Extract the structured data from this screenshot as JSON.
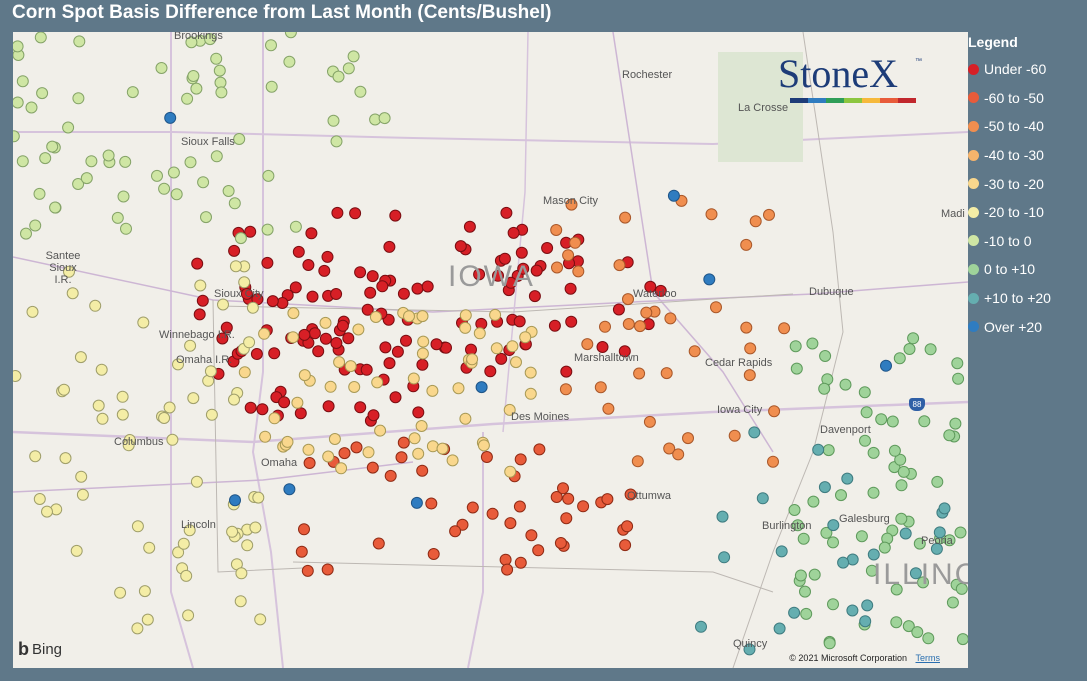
{
  "title": "Corn Spot Basis Difference from Last Month (Cents/Bushel)",
  "legend": {
    "title": "Legend",
    "items": [
      {
        "label": "Under -60",
        "color": "#d71f26"
      },
      {
        "label": "-60 to -50",
        "color": "#e85b3a"
      },
      {
        "label": "-50 to -40",
        "color": "#f08e4f"
      },
      {
        "label": "-40 to -30",
        "color": "#f6b46c"
      },
      {
        "label": "-30 to -20",
        "color": "#f9d78d"
      },
      {
        "label": "-20 to -10",
        "color": "#f4eda6"
      },
      {
        "label": "-10 to 0",
        "color": "#cfe6a4"
      },
      {
        "label": "0 to +10",
        "color": "#9fd39a"
      },
      {
        "label": "+10 to +20",
        "color": "#65aeb0"
      },
      {
        "label": "Over +20",
        "color": "#2f7cc0"
      }
    ]
  },
  "state_label": "IOWA",
  "state_label_2": "ILLINO",
  "cities": [
    "Brookings",
    "Rochester",
    "La Crosse",
    "Sioux Falls",
    "Mason City",
    "Madi",
    "Santee Sioux I.R.",
    "Sioux City",
    "Waterloo",
    "Dubuque",
    "Winnebago I.R.",
    "Omaha I.R.",
    "Marshalltown",
    "Cedar Rapids",
    "Columbus",
    "Des Moines",
    "Iowa City",
    "Davenport",
    "Omaha",
    "Ottumwa",
    "Galesburg",
    "Lincoln",
    "Burlington",
    "Peoria",
    "Quincy"
  ],
  "logo": {
    "brand": "StoneX",
    "tm": "™"
  },
  "attribution": {
    "bing": "Bing",
    "copyright": "© 2021 Microsoft Corporation",
    "terms": "Terms"
  },
  "highway_shields": [
    "88"
  ],
  "map_points_note": "",
  "point_clusters": [
    {
      "region": "central-iowa-north",
      "category": 0,
      "count": 95
    },
    {
      "region": "western-iowa",
      "category": 0,
      "count": 40
    },
    {
      "region": "southern-iowa",
      "category": 1,
      "count": 45
    },
    {
      "region": "eastern-iowa",
      "category": 2,
      "count": 40
    },
    {
      "region": "central-iowa-south",
      "category": 4,
      "count": 60
    },
    {
      "region": "nebraska",
      "category": 5,
      "count": 70
    },
    {
      "region": "dakota-minnesota",
      "category": 6,
      "count": 70
    },
    {
      "region": "illinois",
      "category": 7,
      "count": 70
    },
    {
      "region": "mississippi",
      "category": 8,
      "count": 25
    },
    {
      "region": "scattered",
      "category": 9,
      "count": 8
    }
  ]
}
